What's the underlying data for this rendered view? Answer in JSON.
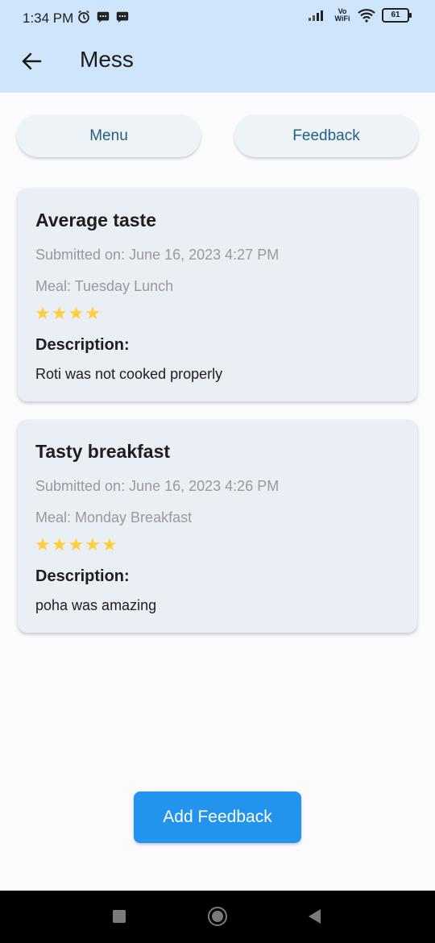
{
  "status_bar": {
    "time": "1:34 PM",
    "vowifi": "Vo WiFi",
    "battery": "61"
  },
  "app_bar": {
    "title": "Mess",
    "back_icon": "arrow-left-icon"
  },
  "tabs": [
    {
      "label": "Menu"
    },
    {
      "label": "Feedback"
    }
  ],
  "feedback": [
    {
      "title": "Average taste",
      "submitted": "Submitted on: June 16, 2023 4:27 PM",
      "meal": "Meal: Tuesday Lunch",
      "rating": 4,
      "description_label": "Description:",
      "description": "Roti was not cooked properly"
    },
    {
      "title": "Tasty breakfast",
      "submitted": "Submitted on: June 16, 2023 4:26 PM",
      "meal": "Meal: Monday Breakfast",
      "rating": 5,
      "description_label": "Description:",
      "description": "poha was amazing"
    }
  ],
  "add_button": {
    "label": "Add Feedback"
  },
  "colors": {
    "app_bar": "#cfe5fb",
    "star": "#ffcf3a",
    "primary_button": "#2294ee",
    "tab_text": "#23607f"
  }
}
